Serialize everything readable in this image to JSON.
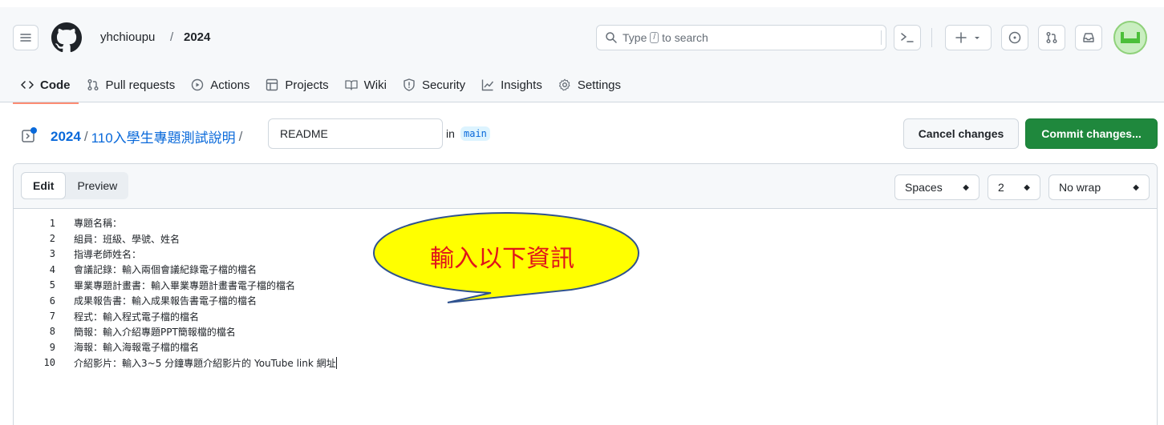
{
  "header": {
    "owner": "yhchioupu",
    "separator": "/",
    "repo": "2024",
    "search_prefix": "Type",
    "search_key": "/",
    "search_suffix": "to search"
  },
  "tabs": [
    {
      "label": "Code",
      "icon": "code-icon"
    },
    {
      "label": "Pull requests",
      "icon": "pull-request-icon"
    },
    {
      "label": "Actions",
      "icon": "play-icon"
    },
    {
      "label": "Projects",
      "icon": "table-icon"
    },
    {
      "label": "Wiki",
      "icon": "book-icon"
    },
    {
      "label": "Security",
      "icon": "shield-icon"
    },
    {
      "label": "Insights",
      "icon": "graph-icon"
    },
    {
      "label": "Settings",
      "icon": "gear-icon"
    }
  ],
  "breadcrumb": {
    "repo": "2024",
    "sep": "/",
    "dir": "110入學生專題測試說明",
    "sep2": "/",
    "filename": "README",
    "in_label": "in",
    "branch": "main"
  },
  "actions": {
    "cancel": "Cancel changes",
    "commit": "Commit changes..."
  },
  "editor": {
    "mode_edit": "Edit",
    "mode_preview": "Preview",
    "indent_mode": "Spaces",
    "indent_size": "2",
    "wrap_mode": "No wrap",
    "lines": [
      {
        "n": "1",
        "text": "專題名稱："
      },
      {
        "n": "2",
        "text": "組員：班級、學號、姓名"
      },
      {
        "n": "3",
        "text": "指導老師姓名："
      },
      {
        "n": "4",
        "text": "會議記錄：輸入兩個會議紀錄電子檔的檔名"
      },
      {
        "n": "5",
        "text": "畢業專題計畫書：輸入畢業專題計畫書電子檔的檔名"
      },
      {
        "n": "6",
        "text": "成果報告書：輸入成果報告書電子檔的檔名"
      },
      {
        "n": "7",
        "text": "程式：輸入程式電子檔的檔名"
      },
      {
        "n": "8",
        "text": "簡報：輸入介紹專題PPT簡報檔的檔名"
      },
      {
        "n": "9",
        "text": "海報：輸入海報電子檔的檔名"
      },
      {
        "n": "10",
        "text": "介紹影片：輸入3~5 分鐘專題介紹影片的 YouTube link 網址"
      }
    ]
  },
  "callout": {
    "text": "輸入以下資訊"
  },
  "colors": {
    "accent_blue": "#0969da",
    "commit_green": "#1f883d",
    "tab_underline": "#fd8c73",
    "callout_fill": "#ffff00",
    "callout_text": "#e0141a"
  }
}
